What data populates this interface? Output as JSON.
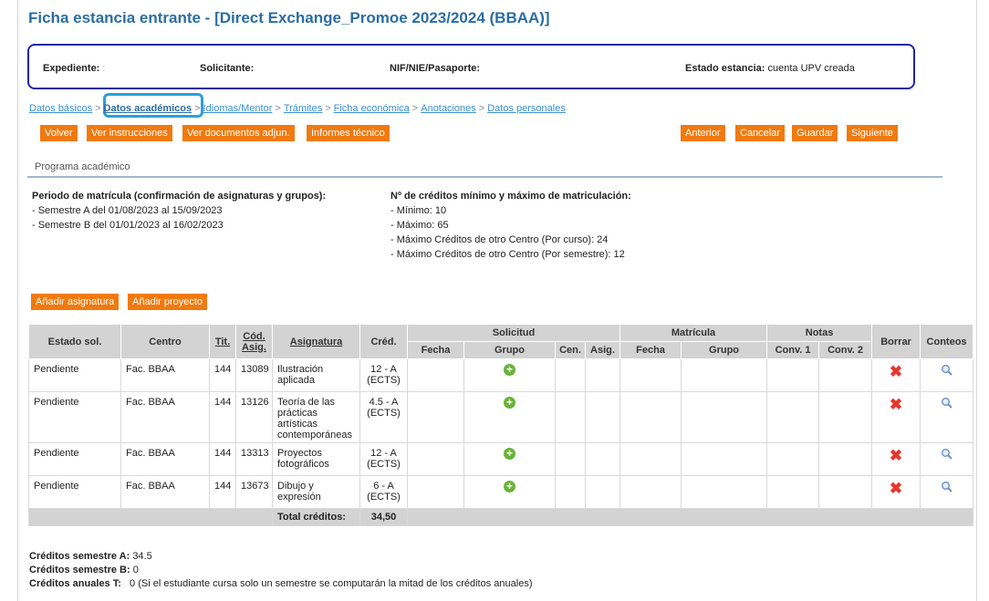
{
  "title": "Ficha estancia entrante - [Direct Exchange_Promoe 2023/2024 (BBAA)]",
  "header": {
    "expediente_label": "Expediente:",
    "expediente_value": ":",
    "solicitante_label": "Solicitante:",
    "nif_label": "NIF/NIE/Pasaporte:",
    "estado_label": "Estado estancia:",
    "estado_value": "cuenta UPV creada"
  },
  "breadcrumb": {
    "items": [
      "Datos básicos",
      "Datos académicos",
      "Idiomas/Mentor",
      "Trámites",
      "Ficha económica",
      "Anotaciones",
      "Datos personales"
    ],
    "separator": ">",
    "active": "Datos académicos"
  },
  "toolbar": {
    "volver": "Volver",
    "ver_instrucciones": "Ver instrucciones",
    "ver_documentos": "Ver documentos adjun.",
    "informes": "Informes técnico",
    "anterior": "Anterior",
    "cancelar": "Cancelar",
    "guardar": "Guardar",
    "siguiente": "Siguiente"
  },
  "section_title": "Programa académico",
  "periodo": {
    "heading": "Periodo de matrícula (confirmación de asignaturas y grupos):",
    "lines": [
      "- Semestre A del 01/08/2023 al 15/09/2023",
      "- Semestre B del 01/01/2023 al 16/02/2023"
    ]
  },
  "creditos_info": {
    "heading": "Nº de créditos mínimo y máximo de matriculación:",
    "lines": [
      "- Mínimo: 10",
      "- Máximo: 65",
      "- Máximo Créditos de otro Centro (Por curso): 24",
      "- Máximo Créditos de otro Centro (Por semestre): 12"
    ]
  },
  "actions": {
    "add_subject": "Añadir asignatura",
    "add_project": "Añadir proyecto"
  },
  "table": {
    "headers": {
      "estado": "Estado sol.",
      "centro": "Centro",
      "tit": "Tit.",
      "cod": "Cód. Asig.",
      "asignatura": "Asignatura",
      "cred": "Créd.",
      "solicitud": "Solicitud",
      "matricula": "Matrícula",
      "notas": "Notas",
      "borrar": "Borrar",
      "conteos": "Conteos"
    },
    "subheaders": {
      "sol_fecha": "Fecha",
      "sol_grupo": "Grupo",
      "sol_cen": "Cen.",
      "sol_asig": "Asig.",
      "mat_fecha": "Fecha",
      "mat_grupo": "Grupo",
      "conv1": "Conv. 1",
      "conv2": "Conv. 2"
    },
    "rows": [
      {
        "estado": "Pendiente",
        "centro": "Fac. BBAA",
        "tit": "144",
        "cod": "13089",
        "asignatura": "Ilustración aplicada",
        "cred": "12 - A (ECTS)"
      },
      {
        "estado": "Pendiente",
        "centro": "Fac. BBAA",
        "tit": "144",
        "cod": "13126",
        "asignatura": "Teoría de las prácticas artísticas contemporáneas",
        "cred": "4.5 - A (ECTS)"
      },
      {
        "estado": "Pendiente",
        "centro": "Fac. BBAA",
        "tit": "144",
        "cod": "13313",
        "asignatura": "Proyectos fotográficos",
        "cred": "12 - A (ECTS)"
      },
      {
        "estado": "Pendiente",
        "centro": "Fac. BBAA",
        "tit": "144",
        "cod": "13673",
        "asignatura": "Dibujo y expresión",
        "cred": "6 - A (ECTS)"
      }
    ],
    "total_label": "Total créditos:",
    "total_value": "34,50"
  },
  "summary": {
    "sem_a_label": "Créditos semestre A:",
    "sem_a_value": "34.5",
    "sem_b_label": "Créditos semestre B:",
    "sem_b_value": "0",
    "anual_label": "Créditos anuales T:",
    "anual_value": "0 (Si el estudiante cursa solo un semestre se computarán la mitad de los créditos anuales)"
  },
  "icons": {
    "add": "plus-circle-icon",
    "delete": "red-x-icon",
    "view": "magnifier-icon"
  },
  "colors": {
    "title": "#2b6da3",
    "button": "#f07a10",
    "highlight": "#2aa0d8",
    "header_box": "#2222aa"
  }
}
